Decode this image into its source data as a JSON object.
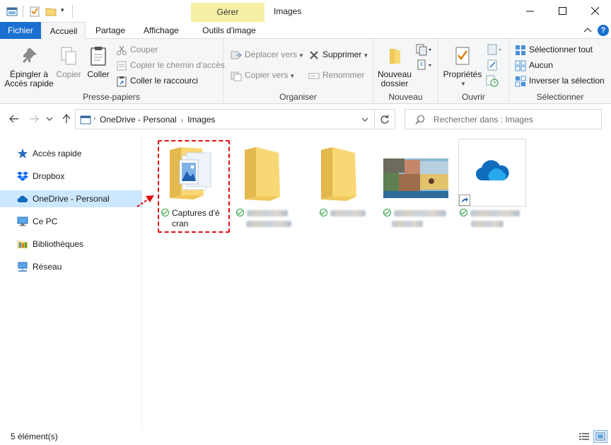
{
  "window": {
    "title": "Images",
    "context_tab": "Gérer",
    "accent_color": "#1a6fd0",
    "context_tab_color": "#f5f0a4"
  },
  "tabs": {
    "fichier": "Fichier",
    "accueil": "Accueil",
    "partage": "Partage",
    "affichage": "Affichage",
    "outils": "Outils d'image"
  },
  "ribbon": {
    "presse_papiers": {
      "label": "Presse-papiers",
      "epingler_line1": "Épingler à",
      "epingler_line2": "Accès rapide",
      "copier": "Copier",
      "coller": "Coller",
      "couper": "Couper",
      "copier_chemin": "Copier le chemin d'accès",
      "coller_raccourci": "Coller le raccourci"
    },
    "organiser": {
      "label": "Organiser",
      "deplacer_vers": "Déplacer vers",
      "copier_vers": "Copier vers",
      "supprimer": "Supprimer",
      "renommer": "Renommer"
    },
    "nouveau": {
      "label": "Nouveau",
      "nouveau_line1": "Nouveau",
      "nouveau_line2": "dossier"
    },
    "ouvrir": {
      "label": "Ouvrir",
      "proprietes": "Propriétés"
    },
    "selectionner": {
      "label": "Sélectionner",
      "tout": "Sélectionner tout",
      "aucun": "Aucun",
      "inverser": "Inverser la sélection"
    }
  },
  "address": {
    "crumbs": [
      "OneDrive - Personal",
      "Images"
    ]
  },
  "search": {
    "placeholder": "Rechercher dans : Images"
  },
  "sidebar": {
    "items": [
      {
        "label": "Accès rapide",
        "icon": "star-icon"
      },
      {
        "label": "Dropbox",
        "icon": "dropbox-icon"
      },
      {
        "label": "OneDrive - Personal",
        "icon": "onedrive-cloud-icon",
        "selected": true
      },
      {
        "label": "Ce PC",
        "icon": "computer-icon"
      },
      {
        "label": "Bibliothèques",
        "icon": "library-icon"
      },
      {
        "label": "Réseau",
        "icon": "network-icon"
      }
    ]
  },
  "files": [
    {
      "name_line1": "Captures d'é",
      "name_line2": "cran",
      "type": "folder-images",
      "synced": true
    },
    {
      "name": "",
      "type": "folder",
      "synced": true,
      "blurred": true
    },
    {
      "name": "",
      "type": "folder",
      "synced": true,
      "blurred": true
    },
    {
      "name": "",
      "type": "image",
      "synced": true,
      "blurred": true
    },
    {
      "name": "",
      "type": "onedrive-shortcut",
      "synced": true,
      "blurred": true
    }
  ],
  "status": {
    "count": "5 élément(s)"
  }
}
